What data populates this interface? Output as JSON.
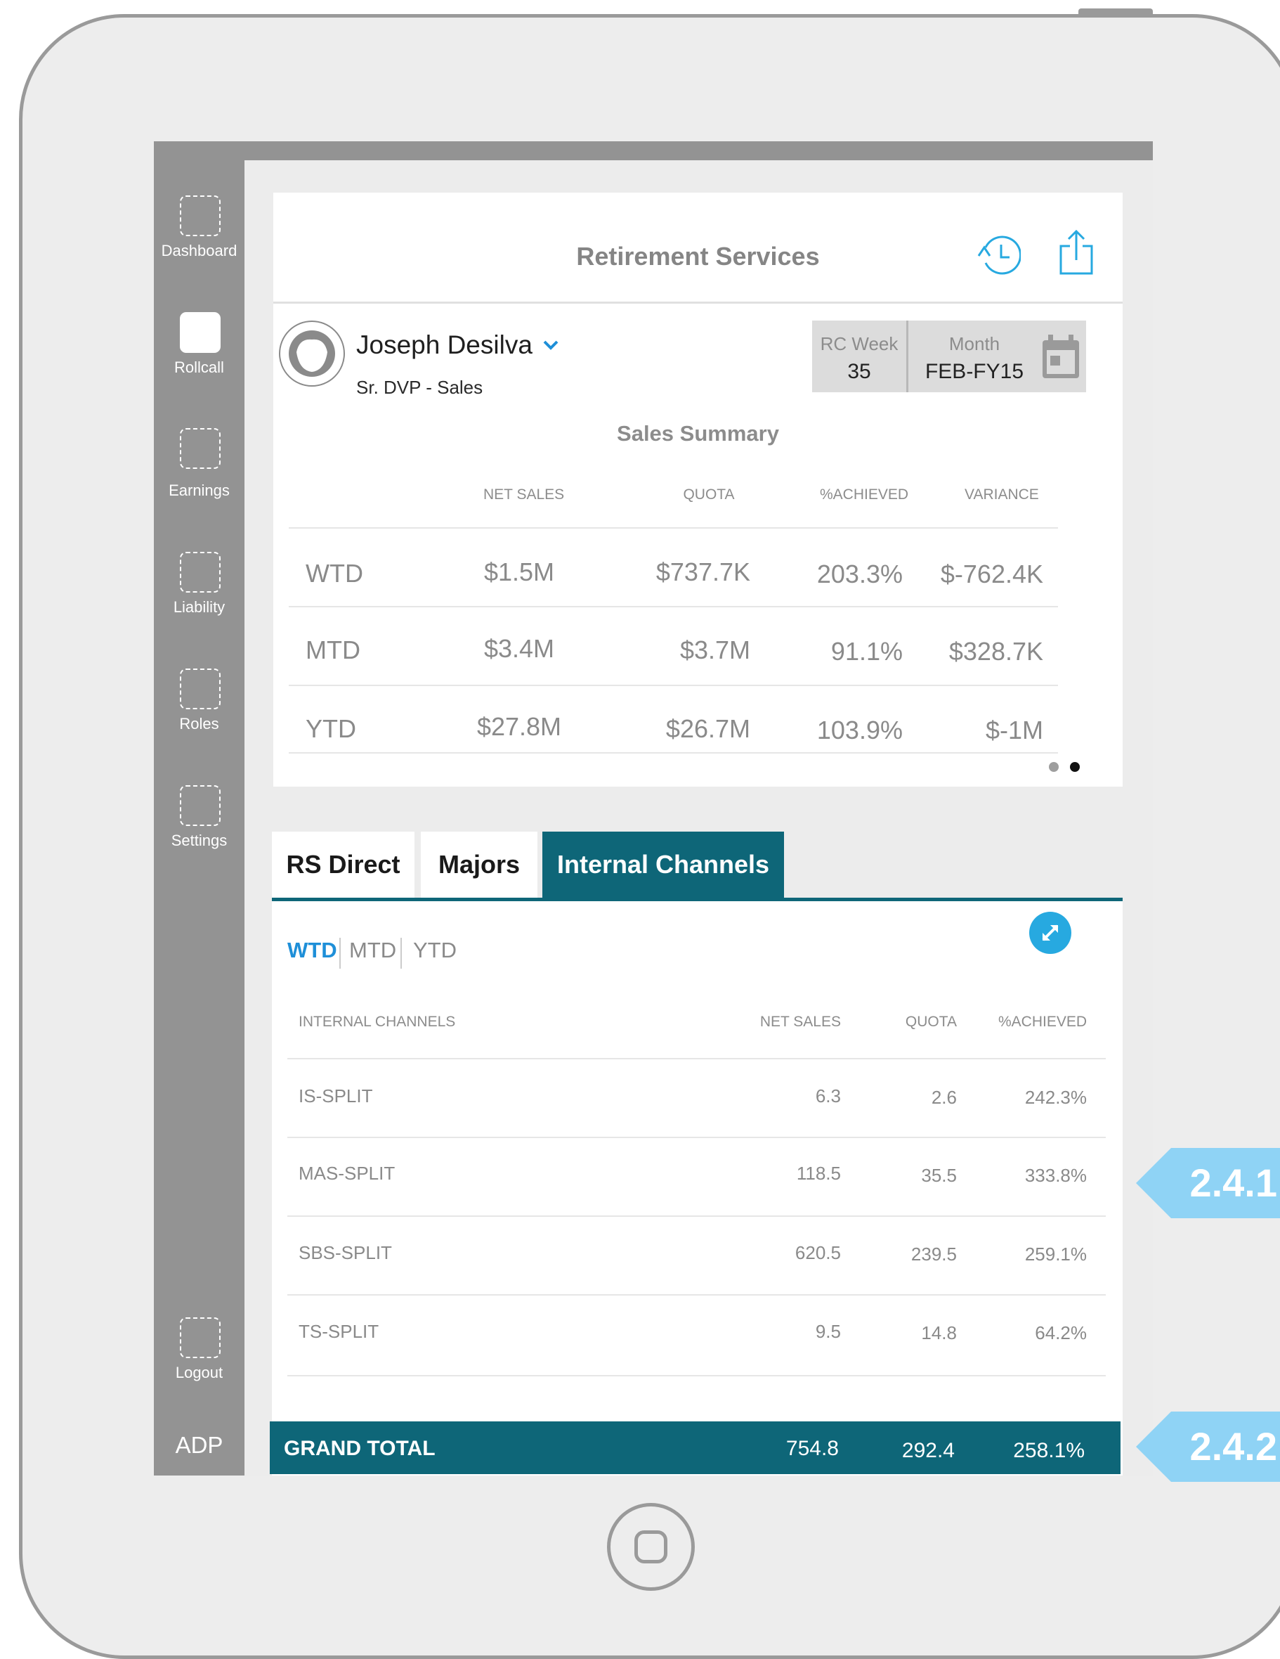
{
  "sidebar": {
    "items": [
      {
        "label": "Dashboard"
      },
      {
        "label": "Rollcall"
      },
      {
        "label": "Earnings"
      },
      {
        "label": "Liability"
      },
      {
        "label": "Roles"
      },
      {
        "label": "Settings"
      },
      {
        "label": "Logout"
      }
    ],
    "brand": "ADP"
  },
  "header": {
    "title": "Retirement Services"
  },
  "user": {
    "name": "Joseph Desilva",
    "title": "Sr. DVP  - Sales"
  },
  "period_selector": {
    "week_label": "RC Week",
    "week_value": "35",
    "month_label": "Month",
    "month_value": "FEB-FY15"
  },
  "summary": {
    "title": "Sales Summary",
    "columns": [
      "NET SALES",
      "QUOTA",
      "%ACHIEVED",
      "VARIANCE"
    ],
    "rows": [
      {
        "label": "WTD",
        "net_sales": "$1.5M",
        "quota": "$737.7K",
        "achieved": "203.3%",
        "variance": "$-762.4K"
      },
      {
        "label": "MTD",
        "net_sales": "$3.4M",
        "quota": "$3.7M",
        "achieved": "91.1%",
        "variance": "$328.7K"
      },
      {
        "label": "YTD",
        "net_sales": "$27.8M",
        "quota": "$26.7M",
        "achieved": "103.9%",
        "variance": "$-1M"
      }
    ],
    "pager": {
      "pages": 2,
      "current": 2
    }
  },
  "tabs": [
    {
      "label": "RS Direct",
      "active": false
    },
    {
      "label": "Majors",
      "active": false
    },
    {
      "label": "Internal Channels",
      "active": true
    }
  ],
  "periods": [
    {
      "label": "WTD",
      "active": true
    },
    {
      "label": "MTD",
      "active": false
    },
    {
      "label": "YTD",
      "active": false
    }
  ],
  "detail": {
    "columns": [
      "INTERNAL CHANNELS",
      "NET SALES",
      "QUOTA",
      "%ACHIEVED"
    ],
    "rows": [
      {
        "channel": "IS-SPLIT",
        "net_sales": "6.3",
        "quota": "2.6",
        "achieved": "242.3%"
      },
      {
        "channel": "MAS-SPLIT",
        "net_sales": "118.5",
        "quota": "35.5",
        "achieved": "333.8%"
      },
      {
        "channel": "SBS-SPLIT",
        "net_sales": "620.5",
        "quota": "239.5",
        "achieved": "259.1%"
      },
      {
        "channel": "TS-SPLIT",
        "net_sales": "9.5",
        "quota": "14.8",
        "achieved": "64.2%"
      }
    ],
    "total": {
      "label": "GRAND TOTAL",
      "net_sales": "754.8",
      "quota": "292.4",
      "achieved": "258.1%"
    }
  },
  "annotations": [
    {
      "label": "2.4.1"
    },
    {
      "label": "2.4.2"
    }
  ],
  "colors": {
    "accent": "#0e6678",
    "link": "#1e8fd8",
    "callout": "#8fd3f5",
    "sidebar": "#939393",
    "icon": "#27a9e0"
  },
  "icons": [
    "history-icon",
    "share-icon",
    "avatar-icon",
    "chevron-down-icon",
    "calendar-icon",
    "expand-icon",
    "home-button"
  ]
}
